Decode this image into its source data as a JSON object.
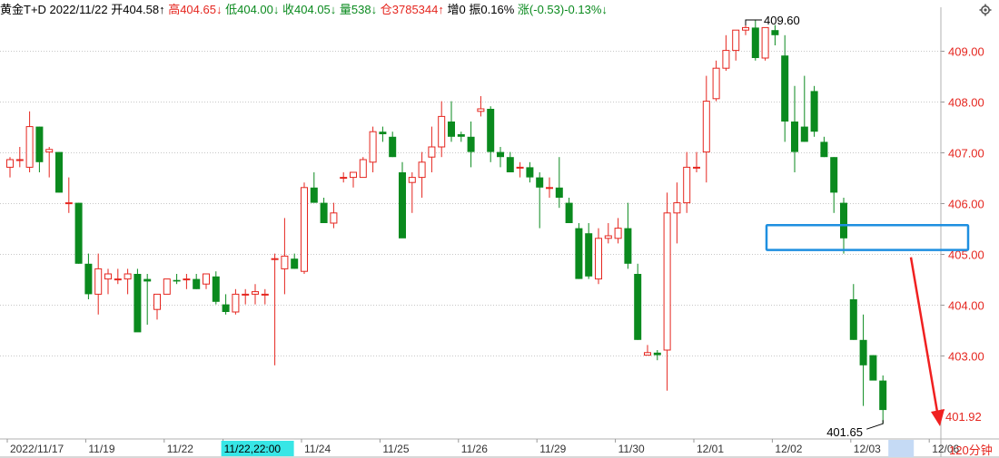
{
  "header": {
    "symbol": "黄金T+D",
    "date": "2022/11/22",
    "open_label": "开",
    "open": "404.58",
    "open_arrow": "↑",
    "high_label": "高",
    "high": "404.65",
    "high_arrow": "↓",
    "low_label": "低",
    "low": "404.00",
    "low_arrow": "↓",
    "close_label": "收",
    "close": "404.05",
    "close_arrow": "↓",
    "volume_label": "量",
    "volume": "538",
    "volume_arrow": "↓",
    "oi_label": "仓",
    "oi": "3785344",
    "oi_arrow": "↑",
    "oi_change_label": "增",
    "oi_change": "0",
    "amplitude_label": "振",
    "amplitude": "0.16%",
    "change_label": "涨",
    "change": "(-0.53)-0.13%",
    "change_arrow": "↓"
  },
  "toolbar": {
    "period_label": "120分钟",
    "settings_icon": "gear-icon"
  },
  "chart_data": {
    "type": "candlestick",
    "y_ticks": [
      "403.00",
      "404.00",
      "405.00",
      "406.00",
      "407.00",
      "408.00",
      "409.00"
    ],
    "ylim": [
      401.35,
      409.85
    ],
    "x_labels": [
      "2022/11/17",
      "11/19",
      "11/22",
      "11/22,22:00",
      "11/24",
      "11/25",
      "11/26",
      "11/29",
      "11/30",
      "12/01",
      "12/02",
      "12/03",
      "12/06"
    ],
    "x_label_bar_index": [
      0,
      8,
      16,
      22,
      30,
      38,
      46,
      54,
      62,
      70,
      78,
      86,
      94
    ],
    "highlighted_x_label": "11/22,22:00",
    "annotations": {
      "high_value": "409.60",
      "low_value": "401.65",
      "last_price": "401.92"
    },
    "colors": {
      "up": "#e5261f",
      "down": "#0a8a1e",
      "grid": "#c8c8c8",
      "highlight_box": "#1e8fe0",
      "arrow": "#f02020",
      "cursor_label_bg": "#37e6e6"
    },
    "candles": [
      [
        406.7,
        406.9,
        406.5,
        406.85
      ],
      [
        406.85,
        407.1,
        406.7,
        406.85
      ],
      [
        406.7,
        407.8,
        406.6,
        407.5
      ],
      [
        407.5,
        407.5,
        406.6,
        406.8
      ],
      [
        407.0,
        407.1,
        406.5,
        407.05
      ],
      [
        407.0,
        407.0,
        406.2,
        406.2
      ],
      [
        406.0,
        406.5,
        405.8,
        406.0
      ],
      [
        406.0,
        406.0,
        404.8,
        404.8
      ],
      [
        404.8,
        405.0,
        404.1,
        404.2
      ],
      [
        404.2,
        405.0,
        403.8,
        404.7
      ],
      [
        404.5,
        404.7,
        404.2,
        404.6
      ],
      [
        404.5,
        404.7,
        404.4,
        404.5
      ],
      [
        404.5,
        404.7,
        404.2,
        404.6
      ],
      [
        404.6,
        404.7,
        403.5,
        403.45
      ],
      [
        404.5,
        404.6,
        403.6,
        404.45
      ],
      [
        403.9,
        404.2,
        403.7,
        404.2
      ],
      [
        404.2,
        404.5,
        404.2,
        404.5
      ],
      [
        404.48,
        404.6,
        404.4,
        404.45
      ],
      [
        404.5,
        404.6,
        404.3,
        404.5
      ],
      [
        404.5,
        404.6,
        404.3,
        404.3
      ],
      [
        404.4,
        404.6,
        404.3,
        404.6
      ],
      [
        404.55,
        404.65,
        404.0,
        404.05
      ],
      [
        404.0,
        404.2,
        403.8,
        403.85
      ],
      [
        403.85,
        404.3,
        403.8,
        404.2
      ],
      [
        404.2,
        404.3,
        404.0,
        404.2
      ],
      [
        404.2,
        404.4,
        404.0,
        404.25
      ],
      [
        404.2,
        404.3,
        404.0,
        404.2
      ],
      [
        404.9,
        405.0,
        402.8,
        404.9
      ],
      [
        404.7,
        405.7,
        404.2,
        404.95
      ],
      [
        404.9,
        405.0,
        404.7,
        404.7
      ],
      [
        404.65,
        406.4,
        404.6,
        406.3
      ],
      [
        406.3,
        406.6,
        406.0,
        406.0
      ],
      [
        406.0,
        406.1,
        405.6,
        405.6
      ],
      [
        405.6,
        406.0,
        405.5,
        405.8
      ],
      [
        406.5,
        406.6,
        406.4,
        406.5
      ],
      [
        406.5,
        406.6,
        406.3,
        406.6
      ],
      [
        406.5,
        406.9,
        406.5,
        406.85
      ],
      [
        406.8,
        407.5,
        406.6,
        407.4
      ],
      [
        407.4,
        407.5,
        407.2,
        407.35
      ],
      [
        407.3,
        407.4,
        406.9,
        406.9
      ],
      [
        406.6,
        406.8,
        405.5,
        405.3
      ],
      [
        406.4,
        406.6,
        405.8,
        406.5
      ],
      [
        406.5,
        407.0,
        406.1,
        406.8
      ],
      [
        406.9,
        407.5,
        406.6,
        407.1
      ],
      [
        407.1,
        408.0,
        406.9,
        407.7
      ],
      [
        407.6,
        408.0,
        407.2,
        407.3
      ],
      [
        407.35,
        407.4,
        407.2,
        407.3
      ],
      [
        407.3,
        407.6,
        406.7,
        407.0
      ],
      [
        407.8,
        408.1,
        407.7,
        407.85
      ],
      [
        407.85,
        407.9,
        406.8,
        407.0
      ],
      [
        407.0,
        407.1,
        406.7,
        406.9
      ],
      [
        406.9,
        407.0,
        406.6,
        406.6
      ],
      [
        406.7,
        406.8,
        406.5,
        406.7
      ],
      [
        406.7,
        406.8,
        406.4,
        406.5
      ],
      [
        406.5,
        406.6,
        405.5,
        406.3
      ],
      [
        406.3,
        406.5,
        406.1,
        406.3
      ],
      [
        406.3,
        406.9,
        405.9,
        406.1
      ],
      [
        406.0,
        406.1,
        405.6,
        405.6
      ],
      [
        405.5,
        405.6,
        404.5,
        404.5
      ],
      [
        405.4,
        405.6,
        404.5,
        404.55
      ],
      [
        404.5,
        405.5,
        404.4,
        405.3
      ],
      [
        405.3,
        405.6,
        405.2,
        405.35
      ],
      [
        405.3,
        405.7,
        405.2,
        405.5
      ],
      [
        405.5,
        406.0,
        404.7,
        404.8
      ],
      [
        404.6,
        404.8,
        403.3,
        403.3
      ],
      [
        403.0,
        403.2,
        403.0,
        403.05
      ],
      [
        403.05,
        403.1,
        402.9,
        403.0
      ],
      [
        403.1,
        406.2,
        402.3,
        405.8
      ],
      [
        405.8,
        406.4,
        405.2,
        406.0
      ],
      [
        406.0,
        407.0,
        405.8,
        406.7
      ],
      [
        406.7,
        407.0,
        406.6,
        406.7
      ],
      [
        407.0,
        408.5,
        406.4,
        408.0
      ],
      [
        408.05,
        408.8,
        408.0,
        408.65
      ],
      [
        408.65,
        409.3,
        408.6,
        409.0
      ],
      [
        409.0,
        409.4,
        408.8,
        409.4
      ],
      [
        409.4,
        409.55,
        409.3,
        409.45
      ],
      [
        409.45,
        409.6,
        408.8,
        408.85
      ],
      [
        408.85,
        409.4,
        408.8,
        409.45
      ],
      [
        409.4,
        409.5,
        409.1,
        409.3
      ],
      [
        408.9,
        409.3,
        407.2,
        407.6
      ],
      [
        407.6,
        408.3,
        406.6,
        407.0
      ],
      [
        407.5,
        408.5,
        407.2,
        407.2
      ],
      [
        408.2,
        408.3,
        407.3,
        407.4
      ],
      [
        407.2,
        407.3,
        406.9,
        406.9
      ],
      [
        406.9,
        406.9,
        405.8,
        406.2
      ],
      [
        406.0,
        406.1,
        405.0,
        405.3
      ],
      [
        404.1,
        404.4,
        403.3,
        403.3
      ],
      [
        403.3,
        403.8,
        402.0,
        402.8
      ],
      [
        403.0,
        403.0,
        402.6,
        402.5
      ],
      [
        402.5,
        402.6,
        401.65,
        401.92
      ]
    ]
  }
}
